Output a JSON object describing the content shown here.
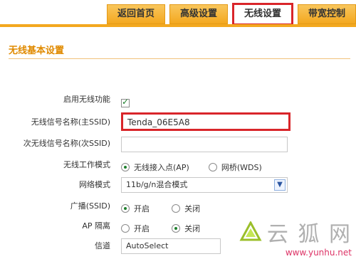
{
  "tabs": [
    {
      "label": "返回首页",
      "active": false
    },
    {
      "label": "高级设置",
      "active": false
    },
    {
      "label": "无线设置",
      "active": true
    },
    {
      "label": "带宽控制",
      "active": false
    }
  ],
  "section": {
    "title": "无线基本设置"
  },
  "fields": {
    "enable_wireless": {
      "label": "启用无线功能",
      "checked": true
    },
    "ssid_primary": {
      "label": "无线信号名称(主SSID)",
      "value": "Tenda_06E5A8"
    },
    "ssid_secondary": {
      "label": "次无线信号名称(次SSID)",
      "value": ""
    },
    "work_mode": {
      "label": "无线工作模式",
      "options": [
        "无线接入点(AP)",
        "网桥(WDS)"
      ],
      "selected": "无线接入点(AP)"
    },
    "network_mode": {
      "label": "网络模式",
      "value": "11b/g/n混合模式"
    },
    "broadcast": {
      "label": "广播(SSID)",
      "options": [
        "开启",
        "关闭"
      ],
      "selected": "开启"
    },
    "ap_isolation": {
      "label": "AP 隔离",
      "options": [
        "开启",
        "关闭"
      ],
      "selected": "关闭"
    },
    "channel": {
      "label": "信道",
      "value": "AutoSelect"
    }
  },
  "watermark": {
    "text": "云 狐 网",
    "url": "www.yunhu.net"
  },
  "colors": {
    "tab_gradient_top": "#f9c65c",
    "tab_gradient_bottom": "#f3a81f",
    "highlight_red": "#d9252a",
    "section_title": "#e08a00"
  }
}
